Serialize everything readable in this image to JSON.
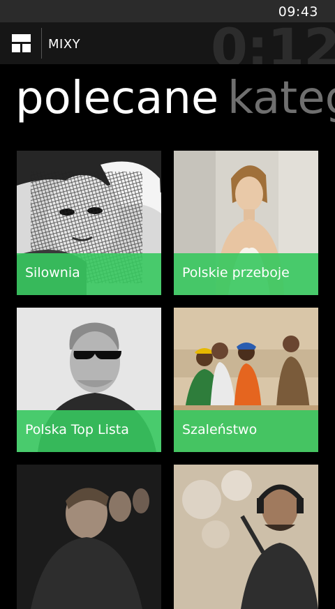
{
  "status": {
    "time": "09:43"
  },
  "app": {
    "title": "MIXY",
    "timer": "0:12"
  },
  "pivot": {
    "active": "polecane",
    "next": "kateg"
  },
  "tiles": [
    {
      "label": "Silownia"
    },
    {
      "label": "Polskie przeboje"
    },
    {
      "label": "Polska Top Lista"
    },
    {
      "label": "Szaleństwo"
    },
    {
      "label": ""
    },
    {
      "label": ""
    }
  ],
  "colors": {
    "accent": "#37c85f",
    "background": "#000000",
    "appbar": "#161616"
  }
}
